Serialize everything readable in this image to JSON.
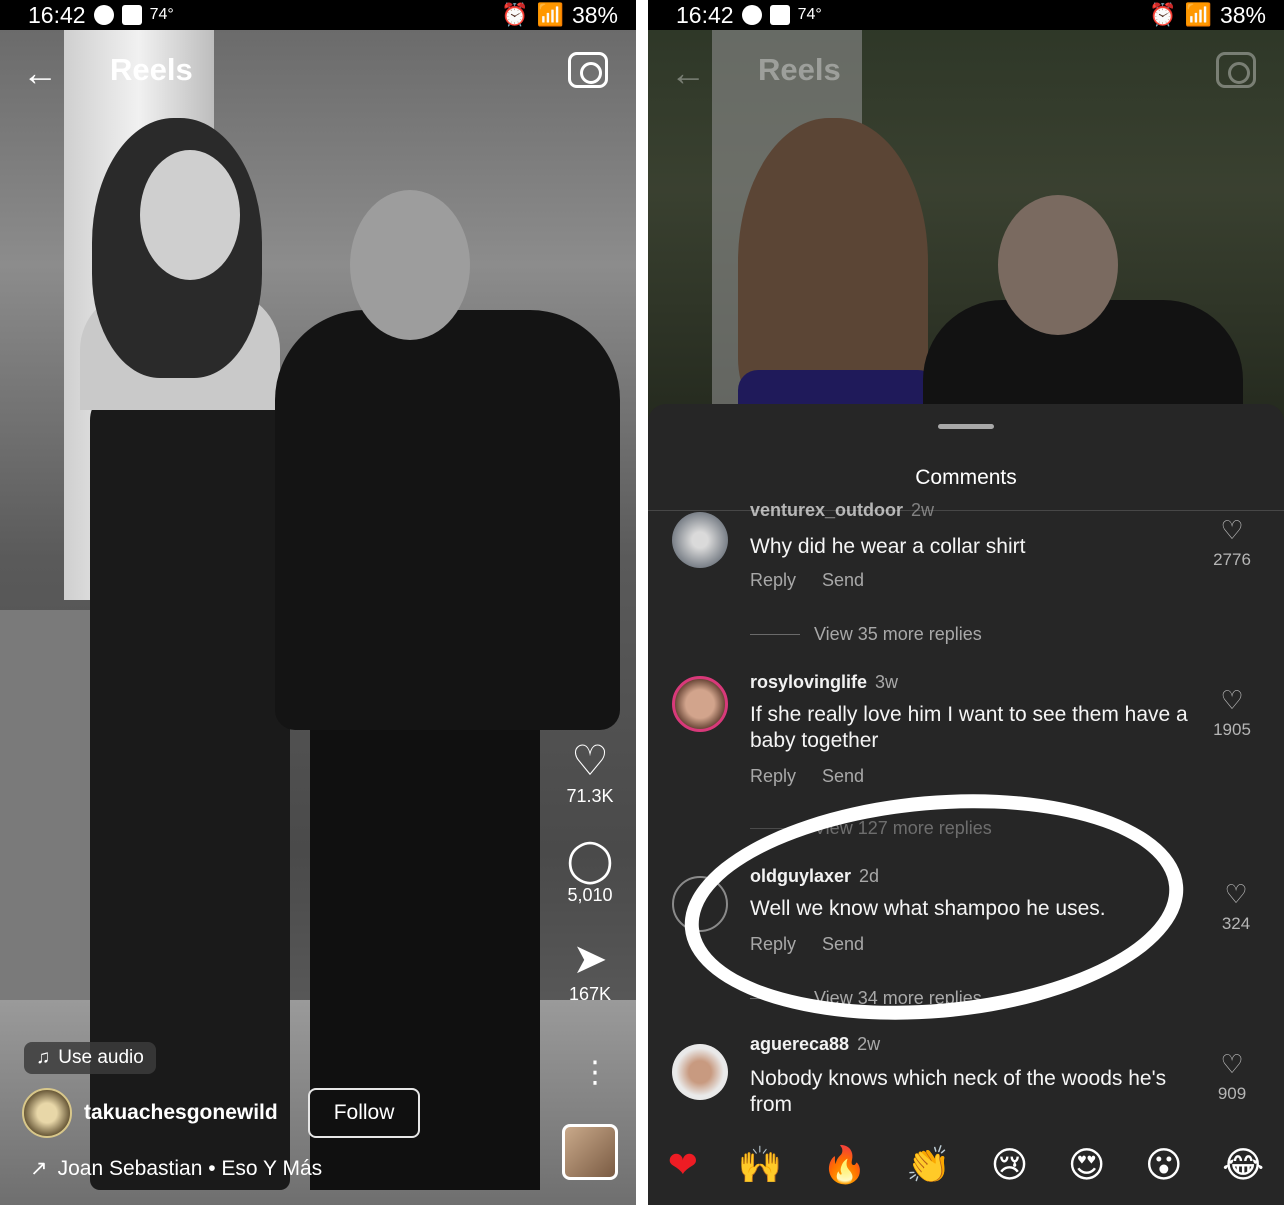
{
  "status_bar": {
    "time": "16:42",
    "temperature": "74°",
    "battery": "38%"
  },
  "left": {
    "nav": {
      "title": "Reels"
    },
    "actions": {
      "likes": "71.3K",
      "comments": "5,010",
      "shares": "167K"
    },
    "use_audio_label": "Use audio",
    "username": "takuachesgonewild",
    "follow_label": "Follow",
    "song": "Joan Sebastian • Eso Y Más"
  },
  "right": {
    "nav": {
      "title": "Reels"
    },
    "sheet_title": "Comments",
    "comments": [
      {
        "user": "venturex_outdoor",
        "age": "2w",
        "text": "Why did he wear a collar shirt",
        "reply": "Reply",
        "send": "Send",
        "likes": "2776",
        "view_more": "View 35 more replies"
      },
      {
        "user": "rosylovinglife",
        "age": "3w",
        "text": "If she really love him I want to see them have a baby together",
        "reply": "Reply",
        "send": "Send",
        "likes": "1905",
        "view_more": "View 127 more replies"
      },
      {
        "user": "oldguylaxer",
        "age": "2d",
        "text": "Well we know what shampoo he uses.",
        "reply": "Reply",
        "send": "Send",
        "likes": "324",
        "view_more": "View 34 more replies"
      },
      {
        "user": "aguereca88",
        "age": "2w",
        "text": "Nobody knows which neck of the woods he's from",
        "likes": "909"
      }
    ],
    "emojis": [
      "❤",
      "🙌",
      "🔥",
      "👏",
      "😢",
      "😍",
      "😮",
      "😂"
    ]
  },
  "colors": {
    "sheet_bg": "#262626",
    "text_secondary": "#a8a8a8",
    "heart_red": "#ed1c24"
  }
}
